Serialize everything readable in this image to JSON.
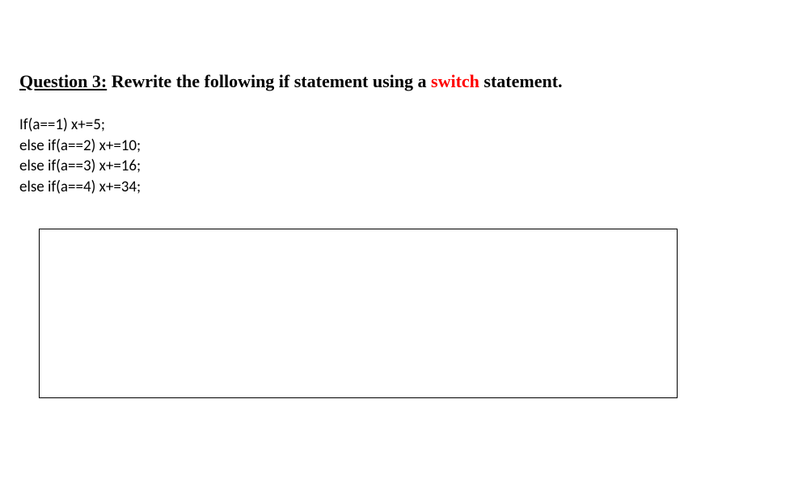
{
  "question": {
    "label": "Question 3:",
    "prompt_before": "  Rewrite the following if statement using a ",
    "keyword": "switch",
    "prompt_after": " statement."
  },
  "code": {
    "lines": [
      "If(a==1) x+=5;",
      "else if(a==2) x+=10;",
      "else if(a==3) x+=16;",
      "else if(a==4) x+=34;"
    ]
  },
  "answer_box": {
    "value": ""
  }
}
